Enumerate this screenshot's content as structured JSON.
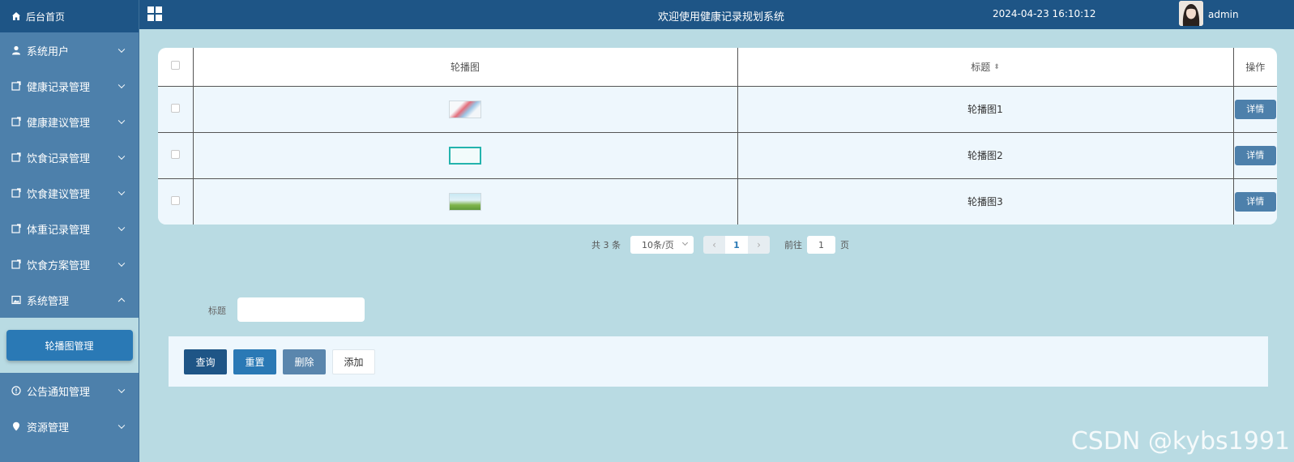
{
  "sidebar": {
    "home": "后台首页",
    "items": [
      {
        "label": "系统用户",
        "icon": "user-icon"
      },
      {
        "label": "健康记录管理",
        "icon": "document-icon"
      },
      {
        "label": "健康建议管理",
        "icon": "document-icon"
      },
      {
        "label": "饮食记录管理",
        "icon": "document-icon"
      },
      {
        "label": "饮食建议管理",
        "icon": "document-icon"
      },
      {
        "label": "体重记录管理",
        "icon": "document-icon"
      },
      {
        "label": "饮食方案管理",
        "icon": "document-icon"
      },
      {
        "label": "系统管理",
        "icon": "picture-icon"
      }
    ],
    "sub_item": "轮播图管理",
    "bottom_items": [
      {
        "label": "公告通知管理",
        "icon": "info-icon"
      },
      {
        "label": "资源管理",
        "icon": "location-icon"
      }
    ]
  },
  "header": {
    "title": "欢迎使用健康记录规划系统",
    "datetime": "2024-04-23 16:10:12",
    "username": "admin"
  },
  "table": {
    "columns": [
      "轮播图",
      "标题",
      "操作"
    ],
    "rows": [
      {
        "title": "轮播图1",
        "action": "详情"
      },
      {
        "title": "轮播图2",
        "action": "详情"
      },
      {
        "title": "轮播图3",
        "action": "详情"
      }
    ]
  },
  "pagination": {
    "total": "共 3 条",
    "page_size": "10条/页",
    "current": "1",
    "goto_label": "前往",
    "goto_value": "1",
    "page_suffix": "页"
  },
  "search": {
    "label": "标题",
    "value": ""
  },
  "actions": {
    "query": "查询",
    "reset": "重置",
    "delete": "删除",
    "add": "添加"
  },
  "watermark": "CSDN @kybs1991",
  "colors": {
    "header_bg": "#1e5586",
    "sidebar_bg": "#4d80ab",
    "content_bg": "#b9dbe3",
    "accent": "#2a79b5"
  }
}
